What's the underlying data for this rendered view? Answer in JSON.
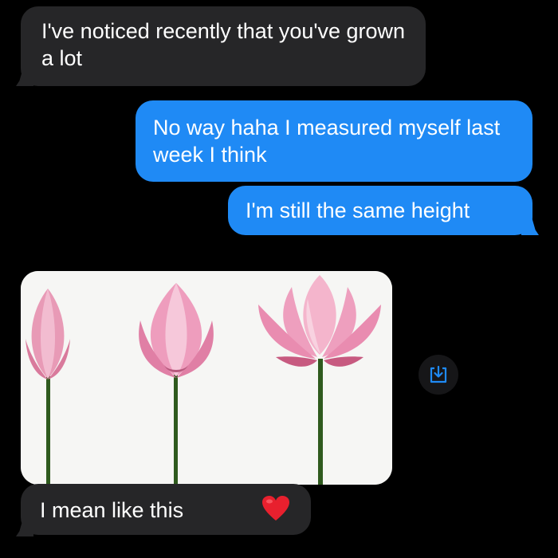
{
  "conversation": {
    "messages": [
      {
        "sender": "other",
        "text": "I've noticed recently that you've grown a lot"
      },
      {
        "sender": "me",
        "text": "No way haha I measured myself last week I think"
      },
      {
        "sender": "me",
        "text": "I'm still the same height"
      },
      {
        "sender": "other",
        "text": "I mean like this",
        "reaction": "heart"
      }
    ],
    "photo": {
      "type": "image",
      "subject": "lotus flowers in three stages of bloom"
    }
  },
  "icons": {
    "save_icon": "save-to-device-icon",
    "reaction_icon": "red-heart-icon"
  },
  "colors": {
    "background": "#000000",
    "incoming_bubble": "#262628",
    "outgoing_bubble": "#1f8af5",
    "accent": "#1f8af5",
    "heart": "#e8202e"
  }
}
